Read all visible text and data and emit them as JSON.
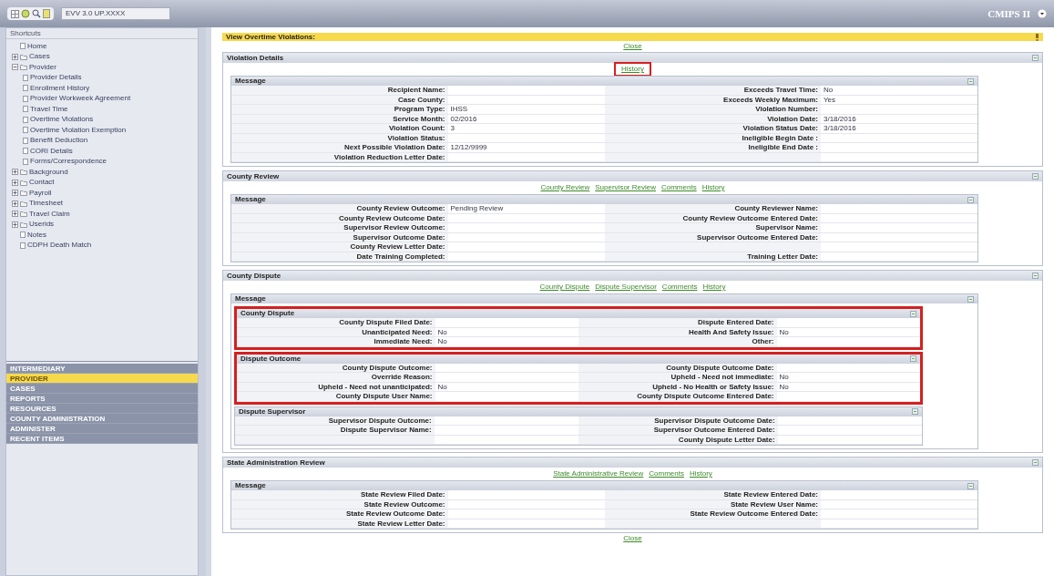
{
  "app": {
    "title": "CMIPS II",
    "toolbar_field": "EVV 3.0 UP.XXXX"
  },
  "sidebar": {
    "title": "Shortcuts",
    "tree": [
      {
        "label": "Home",
        "kind": "page"
      },
      {
        "label": "Cases",
        "kind": "folder",
        "expanded": false
      },
      {
        "label": "Provider",
        "kind": "folder",
        "expanded": true,
        "children": [
          {
            "label": "Provider Details",
            "kind": "page"
          },
          {
            "label": "Enrollment History",
            "kind": "page"
          },
          {
            "label": "Provider Workweek Agreement",
            "kind": "page"
          },
          {
            "label": "Travel Time",
            "kind": "page"
          },
          {
            "label": "Overtime Violations",
            "kind": "page"
          },
          {
            "label": "Overtime Violation Exemption",
            "kind": "page"
          },
          {
            "label": "Benefit Deduction",
            "kind": "page"
          },
          {
            "label": "CORI Details",
            "kind": "page"
          },
          {
            "label": "Forms/Correspondence",
            "kind": "page"
          }
        ]
      },
      {
        "label": "Background",
        "kind": "folder",
        "expanded": false
      },
      {
        "label": "Contact",
        "kind": "folder",
        "expanded": false
      },
      {
        "label": "Payroll",
        "kind": "folder",
        "expanded": false
      },
      {
        "label": "Timesheet",
        "kind": "folder",
        "expanded": false
      },
      {
        "label": "Travel Claim",
        "kind": "folder",
        "expanded": false
      },
      {
        "label": "Userids",
        "kind": "folder",
        "expanded": false
      },
      {
        "label": "Notes",
        "kind": "page"
      },
      {
        "label": "CDPH Death Match",
        "kind": "page"
      }
    ],
    "nav": [
      {
        "label": "INTERMEDIARY",
        "selected": false
      },
      {
        "label": "PROVIDER",
        "selected": true
      },
      {
        "label": "CASES",
        "selected": false
      },
      {
        "label": "REPORTS",
        "selected": false
      },
      {
        "label": "RESOURCES",
        "selected": false
      },
      {
        "label": "COUNTY ADMINISTRATION",
        "selected": false
      },
      {
        "label": "ADMINISTER",
        "selected": false
      },
      {
        "label": "RECENT ITEMS",
        "selected": false
      }
    ]
  },
  "page": {
    "title": "View Overtime Violations:",
    "close_top": "Close",
    "close_bottom": "Close"
  },
  "sections": [
    {
      "title": "Violation Details",
      "links": [
        {
          "label": "History",
          "highlighted": true
        }
      ],
      "panels": [
        {
          "title": "Message",
          "highlighted": false,
          "rows": [
            [
              {
                "label": "Recipient Name:"
              },
              {
                "label": "Exceeds Travel Time:",
                "value": "No"
              }
            ],
            [
              {
                "label": "Case County:"
              },
              {
                "label": "Exceeds Weekly Maximum:",
                "value": "Yes"
              }
            ],
            [
              {
                "label": "Program Type:",
                "value": "IHSS"
              },
              {
                "label": "Violation Number:"
              }
            ],
            [
              {
                "label": "Service Month:",
                "value": "02/2016"
              },
              {
                "label": "Violation Date:",
                "value": "3/18/2016"
              }
            ],
            [
              {
                "label": "Violation Count:",
                "value": "3"
              },
              {
                "label": "Violation Status Date:",
                "value": "3/18/2016"
              }
            ],
            [
              {
                "label": "Violation Status:"
              },
              {
                "label": "Ineligible Begin Date :"
              }
            ],
            [
              {
                "label": "Next Possible Violation Date:",
                "value": "12/12/9999"
              },
              {
                "label": "Ineligible End Date :"
              }
            ],
            [
              {
                "label": "Violation Reduction Letter Date:"
              },
              null
            ]
          ]
        }
      ]
    },
    {
      "title": "County Review",
      "links": [
        {
          "label": "County Review",
          "highlighted": false
        },
        {
          "label": "Supervisor Review",
          "highlighted": false
        },
        {
          "label": "Comments",
          "highlighted": false
        },
        {
          "label": "History",
          "highlighted": false
        }
      ],
      "panels": [
        {
          "title": "Message",
          "highlighted": false,
          "rows": [
            [
              {
                "label": "County Review Outcome:",
                "value": "Pending Review"
              },
              {
                "label": "County Reviewer Name:"
              }
            ],
            [
              {
                "label": "County Review Outcome Date:"
              },
              {
                "label": "County Review Outcome Entered Date:"
              }
            ],
            [
              {
                "label": "Supervisor Review Outcome:"
              },
              {
                "label": "Supervisor Name:"
              }
            ],
            [
              {
                "label": "Supervisor Outcome Date:"
              },
              {
                "label": "Supervisor Outcome Entered Date:"
              }
            ],
            [
              {
                "label": "County Review Letter Date:"
              },
              null
            ],
            [
              {
                "label": "Date Training Completed:"
              },
              {
                "label": "Training Letter Date:"
              }
            ]
          ]
        }
      ]
    },
    {
      "title": "County Dispute",
      "links": [
        {
          "label": "County Dispute",
          "highlighted": false
        },
        {
          "label": "Dispute Supervisor",
          "highlighted": false
        },
        {
          "label": "Comments",
          "highlighted": false
        },
        {
          "label": "History",
          "highlighted": false
        }
      ],
      "panels": [
        {
          "title": "Message",
          "highlighted": false,
          "subpanels": [
            {
              "title": "County Dispute",
              "highlighted": true,
              "rows": [
                [
                  {
                    "label": "County Dispute Filed Date:"
                  },
                  {
                    "label": "Dispute Entered Date:"
                  }
                ],
                [
                  {
                    "label": "Unanticipated Need:",
                    "value": "No"
                  },
                  {
                    "label": "Health And Safety Issue:",
                    "value": "No"
                  }
                ],
                [
                  {
                    "label": "Immediate Need:",
                    "value": "No"
                  },
                  {
                    "label": "Other:"
                  }
                ]
              ]
            },
            {
              "title": "Dispute Outcome",
              "highlighted": true,
              "rows": [
                [
                  {
                    "label": "County Dispute Outcome:"
                  },
                  {
                    "label": "County Dispute Outcome Date:"
                  }
                ],
                [
                  {
                    "label": "Override Reason:"
                  },
                  {
                    "label": "Upheld - Need not immediate:",
                    "value": "No"
                  }
                ],
                [
                  {
                    "label": "Upheld - Need not unanticipated:",
                    "value": "No"
                  },
                  {
                    "label": "Upheld - No Health or Safety Issue:",
                    "value": "No"
                  }
                ],
                [
                  {
                    "label": "County Dispute User Name:"
                  },
                  {
                    "label": "County Dispute Outcome Entered Date:"
                  }
                ]
              ]
            },
            {
              "title": "Dispute Supervisor",
              "highlighted": false,
              "rows": [
                [
                  {
                    "label": "Supervisor Dispute Outcome:"
                  },
                  {
                    "label": "Supervisor Dispute Outcome Date:"
                  }
                ],
                [
                  {
                    "label": "Dispute Supervisor Name:"
                  },
                  {
                    "label": "Supervisor Outcome Entered Date:"
                  }
                ],
                [
                  null,
                  {
                    "label": "County Dispute Letter Date:"
                  }
                ]
              ]
            }
          ]
        }
      ]
    },
    {
      "title": "State Administration Review",
      "links": [
        {
          "label": "State Administrative Review",
          "highlighted": false
        },
        {
          "label": "Comments",
          "highlighted": false
        },
        {
          "label": "History",
          "highlighted": false
        }
      ],
      "panels": [
        {
          "title": "Message",
          "highlighted": false,
          "rows": [
            [
              {
                "label": "State Review Filed Date:"
              },
              {
                "label": "State Review Entered Date:"
              }
            ],
            [
              {
                "label": "State Review Outcome:"
              },
              {
                "label": "State Review User Name:"
              }
            ],
            [
              {
                "label": "State Review Outcome Date:"
              },
              {
                "label": "State Review Outcome Entered Date:"
              }
            ],
            [
              {
                "label": "State Review Letter Date:"
              },
              null
            ]
          ]
        }
      ]
    }
  ]
}
